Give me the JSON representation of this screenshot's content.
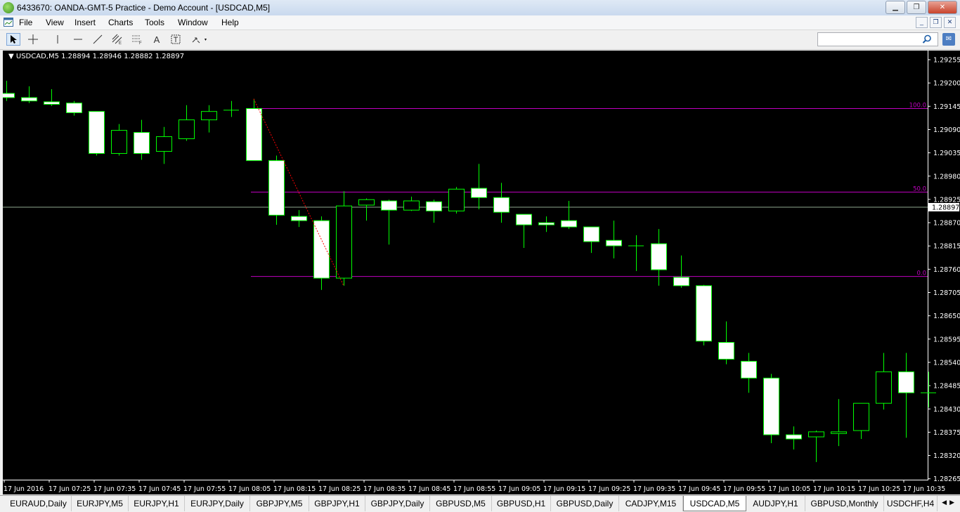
{
  "window": {
    "title": "6433670: OANDA-GMT-5 Practice - Demo Account - [USDCAD,M5]"
  },
  "menu": {
    "items": [
      "File",
      "View",
      "Insert",
      "Charts",
      "Tools",
      "Window",
      "Help"
    ]
  },
  "toolbar": {
    "tools": [
      "cursor-icon",
      "crosshair-icon",
      "vertical-line-icon",
      "horizontal-line-icon",
      "trendline-icon",
      "equidistant-channel-icon",
      "fibonacci-icon",
      "text-icon",
      "text-label-icon",
      "arrows-icon"
    ],
    "text_tool_label": "A",
    "search": {
      "value": "",
      "placeholder": ""
    }
  },
  "chart": {
    "header": "USDCAD,M5  1.28894 1.28946 1.28882 1.28897",
    "current_price_label": "1.28897",
    "colors": {
      "background": "#000000",
      "up_body": "#000000",
      "down_body": "#ffffff",
      "candle_outline": "#00ff00",
      "fib_lines": "#c000c0",
      "bid_line": "#8fa88f",
      "trend_line": "#ff0000"
    }
  },
  "chart_data": {
    "type": "candlestick",
    "symbol": "USDCAD",
    "timeframe": "M5",
    "ylim": [
      1.28265,
      1.29285
    ],
    "y_ticks": [
      "1.29255",
      "1.29200",
      "1.29145",
      "1.29090",
      "1.29035",
      "1.28980",
      "1.28925",
      "1.28870",
      "1.28815",
      "1.28760",
      "1.28705",
      "1.28650",
      "1.28595",
      "1.28540",
      "1.28485",
      "1.28430",
      "1.28375",
      "1.28320",
      "1.28265"
    ],
    "x_ticks": [
      "17 Jun 2016",
      "17 Jun 07:25",
      "17 Jun 07:35",
      "17 Jun 07:45",
      "17 Jun 07:55",
      "17 Jun 08:05",
      "17 Jun 08:15",
      "17 Jun 08:25",
      "17 Jun 08:35",
      "17 Jun 08:45",
      "17 Jun 08:55",
      "17 Jun 09:05",
      "17 Jun 09:15",
      "17 Jun 09:25",
      "17 Jun 09:35",
      "17 Jun 09:45",
      "17 Jun 09:55",
      "17 Jun 10:05",
      "17 Jun 10:15",
      "17 Jun 10:25",
      "17 Jun 10:35"
    ],
    "candles": [
      {
        "o": 1.29168,
        "h": 1.29198,
        "l": 1.2915,
        "c": 1.29158
      },
      {
        "o": 1.29158,
        "h": 1.29185,
        "l": 1.29145,
        "c": 1.2915
      },
      {
        "o": 1.29148,
        "h": 1.29178,
        "l": 1.29138,
        "c": 1.29142
      },
      {
        "o": 1.29145,
        "h": 1.2915,
        "l": 1.29115,
        "c": 1.29122
      },
      {
        "o": 1.29125,
        "h": 1.29125,
        "l": 1.2902,
        "c": 1.29025
      },
      {
        "o": 1.29025,
        "h": 1.29095,
        "l": 1.2902,
        "c": 1.2908
      },
      {
        "o": 1.29075,
        "h": 1.29105,
        "l": 1.2901,
        "c": 1.29025
      },
      {
        "o": 1.2903,
        "h": 1.29088,
        "l": 1.29,
        "c": 1.29065
      },
      {
        "o": 1.2906,
        "h": 1.2914,
        "l": 1.29055,
        "c": 1.29105
      },
      {
        "o": 1.29105,
        "h": 1.2914,
        "l": 1.29075,
        "c": 1.29125
      },
      {
        "o": 1.29128,
        "h": 1.2915,
        "l": 1.29112,
        "c": 1.29128
      },
      {
        "o": 1.29132,
        "h": 1.29155,
        "l": 1.2901,
        "c": 1.29008
      },
      {
        "o": 1.29008,
        "h": 1.2902,
        "l": 1.28855,
        "c": 1.28878
      },
      {
        "o": 1.28875,
        "h": 1.2889,
        "l": 1.2885,
        "c": 1.28865
      },
      {
        "o": 1.28865,
        "h": 1.28875,
        "l": 1.287,
        "c": 1.28728
      },
      {
        "o": 1.28728,
        "h": 1.28935,
        "l": 1.2871,
        "c": 1.289
      },
      {
        "o": 1.28902,
        "h": 1.28918,
        "l": 1.28865,
        "c": 1.28915
      },
      {
        "o": 1.28912,
        "h": 1.28915,
        "l": 1.28808,
        "c": 1.2889
      },
      {
        "o": 1.2889,
        "h": 1.28922,
        "l": 1.28888,
        "c": 1.28912
      },
      {
        "o": 1.2891,
        "h": 1.28915,
        "l": 1.2886,
        "c": 1.28888
      },
      {
        "o": 1.28888,
        "h": 1.28945,
        "l": 1.28882,
        "c": 1.2894
      },
      {
        "o": 1.28942,
        "h": 1.29,
        "l": 1.28892,
        "c": 1.2892
      },
      {
        "o": 1.2892,
        "h": 1.28955,
        "l": 1.2886,
        "c": 1.28885
      },
      {
        "o": 1.2888,
        "h": 1.2888,
        "l": 1.288,
        "c": 1.28855
      },
      {
        "o": 1.2886,
        "h": 1.28875,
        "l": 1.28838,
        "c": 1.28855
      },
      {
        "o": 1.28865,
        "h": 1.28912,
        "l": 1.28845,
        "c": 1.2885
      },
      {
        "o": 1.2885,
        "h": 1.2885,
        "l": 1.28788,
        "c": 1.28815
      },
      {
        "o": 1.28818,
        "h": 1.28865,
        "l": 1.28775,
        "c": 1.28805
      },
      {
        "o": 1.28805,
        "h": 1.2883,
        "l": 1.28745,
        "c": 1.28805
      },
      {
        "o": 1.2881,
        "h": 1.28845,
        "l": 1.2871,
        "c": 1.28748
      },
      {
        "o": 1.2873,
        "h": 1.28782,
        "l": 1.28705,
        "c": 1.2871
      },
      {
        "o": 1.2871,
        "h": 1.28712,
        "l": 1.28568,
        "c": 1.28578
      },
      {
        "o": 1.28575,
        "h": 1.28625,
        "l": 1.28523,
        "c": 1.28535
      },
      {
        "o": 1.2853,
        "h": 1.2855,
        "l": 1.28455,
        "c": 1.2849
      },
      {
        "o": 1.2849,
        "h": 1.285,
        "l": 1.28335,
        "c": 1.28355
      },
      {
        "o": 1.28355,
        "h": 1.28375,
        "l": 1.2832,
        "c": 1.28345
      },
      {
        "o": 1.2835,
        "h": 1.28365,
        "l": 1.2829,
        "c": 1.28362
      },
      {
        "o": 1.28358,
        "h": 1.2844,
        "l": 1.28328,
        "c": 1.28362
      },
      {
        "o": 1.28365,
        "h": 1.2843,
        "l": 1.28345,
        "c": 1.2843
      },
      {
        "o": 1.2843,
        "h": 1.2855,
        "l": 1.28415,
        "c": 1.28505
      },
      {
        "o": 1.28505,
        "h": 1.2855,
        "l": 1.28348,
        "c": 1.28455
      },
      {
        "o": 1.28455,
        "h": 1.28505,
        "l": 1.2842,
        "c": 1.28455
      }
    ],
    "fibonacci": [
      {
        "level": "100.0",
        "price": 1.29132
      },
      {
        "level": "50.0",
        "price": 1.28933
      },
      {
        "level": "0.0",
        "price": 1.28732
      }
    ],
    "bid": 1.28897
  },
  "tabs": {
    "items": [
      "EURAUD,Daily",
      "EURJPY,M5",
      "EURJPY,H1",
      "EURJPY,Daily",
      "GBPJPY,M5",
      "GBPJPY,H1",
      "GBPJPY,Daily",
      "GBPUSD,M5",
      "GBPUSD,H1",
      "GBPUSD,Daily",
      "CADJPY,M15",
      "USDCAD,M5",
      "AUDJPY,H1",
      "GBPUSD,Monthly",
      "USDCHF,H4"
    ],
    "active_index": 11
  }
}
